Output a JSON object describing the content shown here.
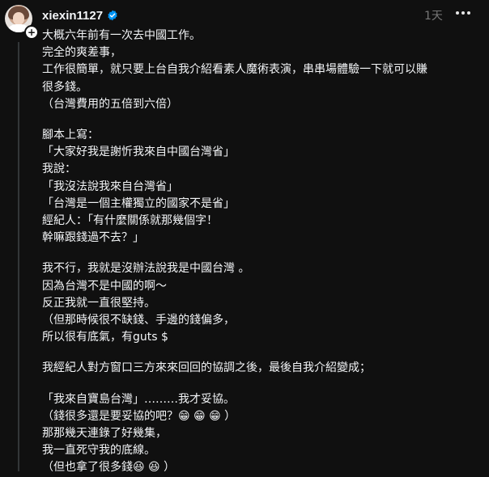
{
  "post": {
    "username": "xiexin1127",
    "timestamp": "1天",
    "verified": true,
    "paragraphs": [
      [
        "大概六年前有一次去中國工作。",
        "完全的爽差事，",
        "工作很簡單，就只要上台自我介紹看素人魔術表演，串串場體驗一下就可以賺",
        "很多錢。",
        "（台灣費用的五倍到六倍）"
      ],
      [
        "腳本上寫：",
        "「大家好我是謝忻我來自中國台灣省」",
        "我說：",
        "「我沒法說我來自台灣省」",
        "「台灣是一個主權獨立的國家不是省」",
        "經紀人：「有什麼關係就那幾個字！",
        "幹嘛跟錢過不去？」"
      ],
      [
        "我不行，我就是沒辦法說我是中國台灣 。",
        "因為台灣不是中國的啊～",
        "反正我就一直很堅持。",
        "（但那時候很不缺錢、手邊的錢偏多，",
        "所以很有底氣，有guts $"
      ],
      [
        "我經紀人對方窗口三方來來回回的協調之後，最後自我介紹變成；"
      ],
      [
        "「我來自寶島台灣」………我才妥協。",
        "（錢很多還是要妥協的吧？😁 😁 😁 ）",
        "那那幾天連錄了好幾集，",
        "我一直死守我的底線。",
        "（但也拿了很多錢😆 😆 ）"
      ]
    ]
  },
  "colors": {
    "background": "#101010",
    "text": "#f3f5f7",
    "muted": "#777777",
    "verified": "#0095f6"
  }
}
